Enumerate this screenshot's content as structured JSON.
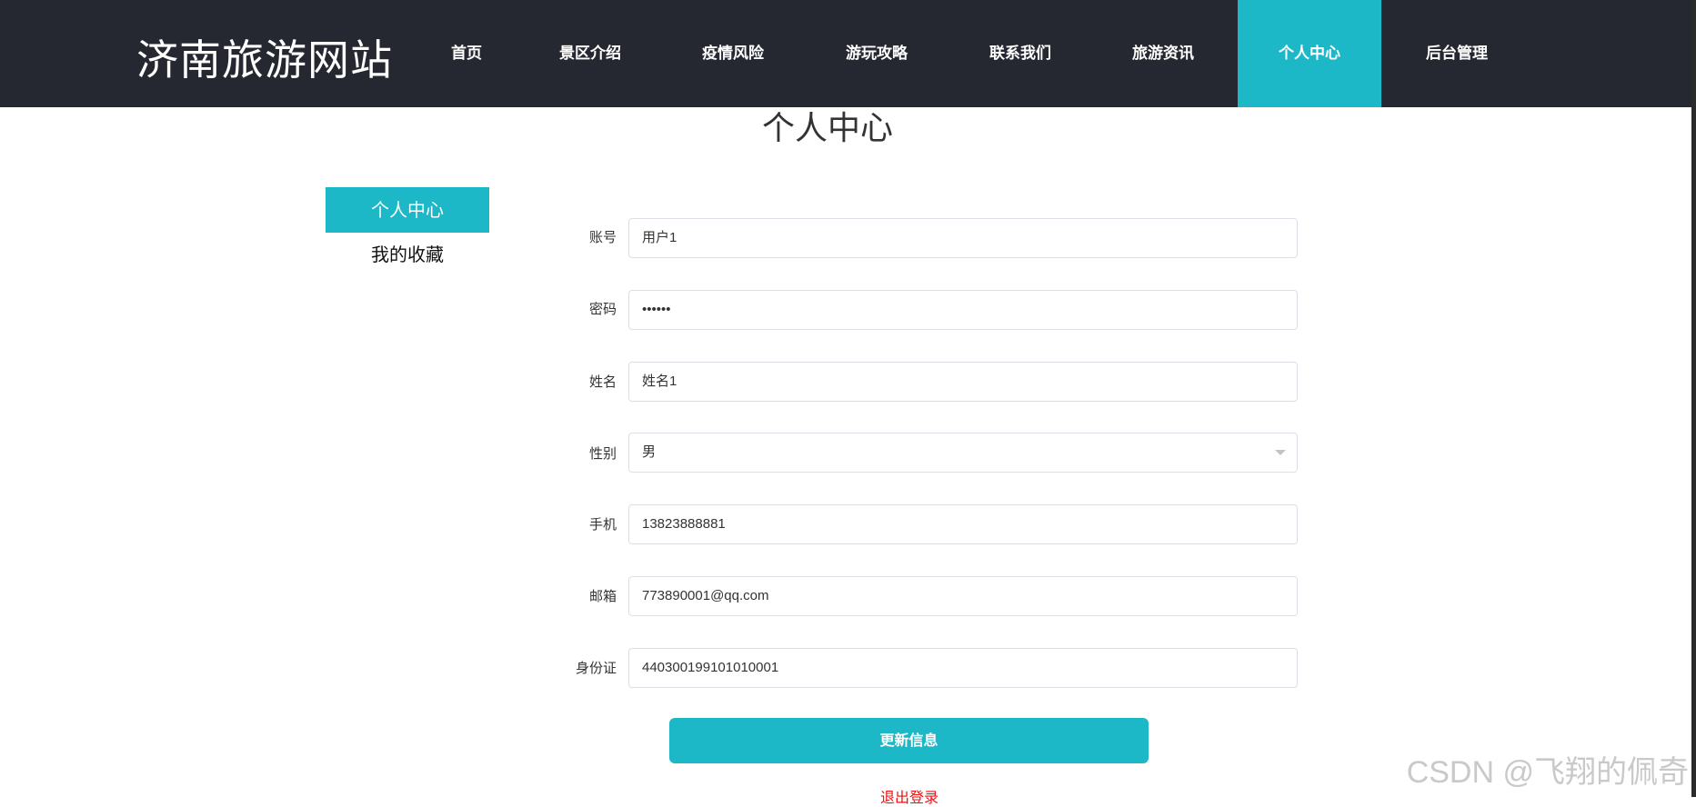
{
  "site": {
    "logo": "济南旅游网站"
  },
  "nav": {
    "items": [
      {
        "label": "首页",
        "active": false
      },
      {
        "label": "景区介绍",
        "active": false
      },
      {
        "label": "疫情风险",
        "active": false
      },
      {
        "label": "游玩攻略",
        "active": false
      },
      {
        "label": "联系我们",
        "active": false
      },
      {
        "label": "旅游资讯",
        "active": false
      },
      {
        "label": "个人中心",
        "active": true
      },
      {
        "label": "后台管理",
        "active": false
      }
    ]
  },
  "page": {
    "title": "个人中心"
  },
  "sidebar": {
    "active_label": "个人中心",
    "link_label": "我的收藏"
  },
  "form": {
    "account": {
      "label": "账号",
      "value": "用户1"
    },
    "password": {
      "label": "密码",
      "value": "••••••"
    },
    "name": {
      "label": "姓名",
      "value": "姓名1"
    },
    "gender": {
      "label": "性别",
      "value": "男"
    },
    "phone": {
      "label": "手机",
      "value": "13823888881"
    },
    "email": {
      "label": "邮箱",
      "value": "773890001@qq.com"
    },
    "id_card": {
      "label": "身份证",
      "value": "440300199101010001"
    },
    "submit_label": "更新信息",
    "logout_label": "退出登录"
  },
  "watermark": "CSDN @飞翔的佩奇",
  "colors": {
    "nav_bg": "#252830",
    "accent": "#1db8c8",
    "logout": "#ee1111"
  }
}
